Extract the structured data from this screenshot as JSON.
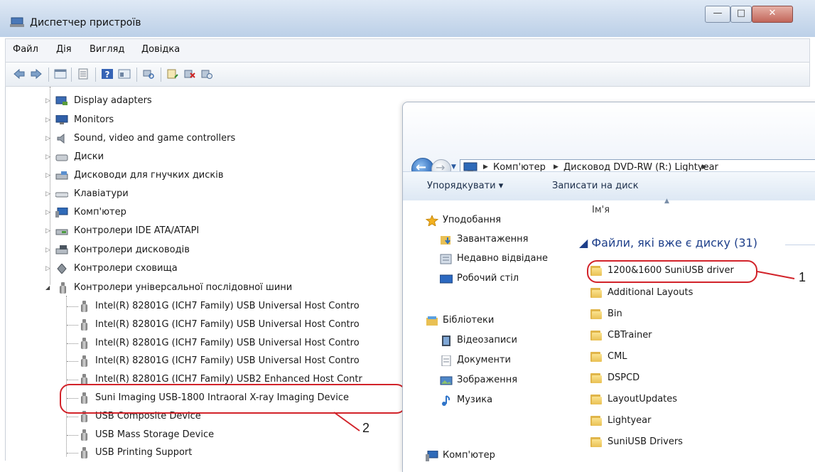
{
  "window": {
    "title": "Диспетчер пристроїв",
    "minimize_glyph": "—",
    "maximize_glyph": "□",
    "close_glyph": "✕"
  },
  "menu": [
    "Файл",
    "Дія",
    "Вигляд",
    "Довідка"
  ],
  "toolbar_icons": [
    "back-arrow-icon",
    "forward-arrow-icon",
    "show-hide-tree-icon",
    "properties-icon",
    "help-icon",
    "view-icon",
    "scan-hardware-icon",
    "update-driver-icon",
    "uninstall-icon",
    "disable-icon"
  ],
  "tree": {
    "categories": [
      {
        "label": "Display adapters",
        "icon": "display-adapter-icon"
      },
      {
        "label": "Monitors",
        "icon": "monitor-icon"
      },
      {
        "label": "Sound, video and game controllers",
        "icon": "speaker-icon"
      },
      {
        "label": "Диски",
        "icon": "disk-drive-icon"
      },
      {
        "label": "Дисководи для гнучких дисків",
        "icon": "floppy-drive-icon"
      },
      {
        "label": "Клавіатури",
        "icon": "keyboard-icon"
      },
      {
        "label": "Комп'ютер",
        "icon": "computer-icon"
      },
      {
        "label": "Контролери IDE ATA/ATAPI",
        "icon": "ide-controller-icon"
      },
      {
        "label": "Контролери дисководів",
        "icon": "floppy-controller-icon"
      },
      {
        "label": "Контролери сховища",
        "icon": "storage-controller-icon"
      },
      {
        "label": "Контролери універсальної послідовної шини",
        "icon": "usb-icon",
        "expanded": true
      }
    ],
    "usb_children": [
      "Intel(R) 82801G (ICH7 Family) USB Universal Host Contro",
      "Intel(R) 82801G (ICH7 Family) USB Universal Host Contro",
      "Intel(R) 82801G (ICH7 Family) USB Universal Host Contro",
      "Intel(R) 82801G (ICH7 Family) USB Universal Host Contro",
      "Intel(R) 82801G (ICH7 Family) USB2 Enhanced Host Contr",
      "Suni Imaging USB-1800 Intraoral X-ray Imaging Device",
      "USB Composite Device",
      "USB Mass Storage Device",
      "USB Printing Support"
    ]
  },
  "explorer": {
    "breadcrumbs": [
      "Комп'ютер",
      "Дисковод DVD-RW (R:) Lightyear"
    ],
    "commands": {
      "organize": "Упорядкувати ▾",
      "burn": "Записати на диск"
    },
    "nav_items": [
      {
        "label": "Уподобання",
        "icon": "star-icon"
      },
      {
        "label": "Завантаження",
        "icon": "downloads-folder-icon"
      },
      {
        "label": "Недавно відвідане",
        "icon": "recent-places-icon"
      },
      {
        "label": "Робочий стіл",
        "icon": "desktop-icon"
      },
      {
        "label": "Бібліотеки",
        "icon": "libraries-icon"
      },
      {
        "label": "Відеозаписи",
        "icon": "videos-icon"
      },
      {
        "label": "Документи",
        "icon": "documents-icon"
      },
      {
        "label": "Зображення",
        "icon": "pictures-icon"
      },
      {
        "label": "Музика",
        "icon": "music-icon"
      },
      {
        "label": "Комп'ютер",
        "icon": "computer-icon"
      }
    ],
    "column_name": "Ім'я",
    "group_header": "◢ Файли, які вже є диску (31)",
    "files": [
      "1200&1600 SuniUSB driver",
      "Additional Layouts",
      "Bin",
      "CBTrainer",
      "CML",
      "DSPCD",
      "LayoutUpdates",
      "Lightyear",
      "SuniUSB Drivers"
    ]
  },
  "annotations": {
    "callout_1": "1",
    "callout_2": "2"
  },
  "colors": {
    "callout": "#d2232a",
    "group_header": "#1e3f8a",
    "titlebar": "#c9d9ec"
  }
}
